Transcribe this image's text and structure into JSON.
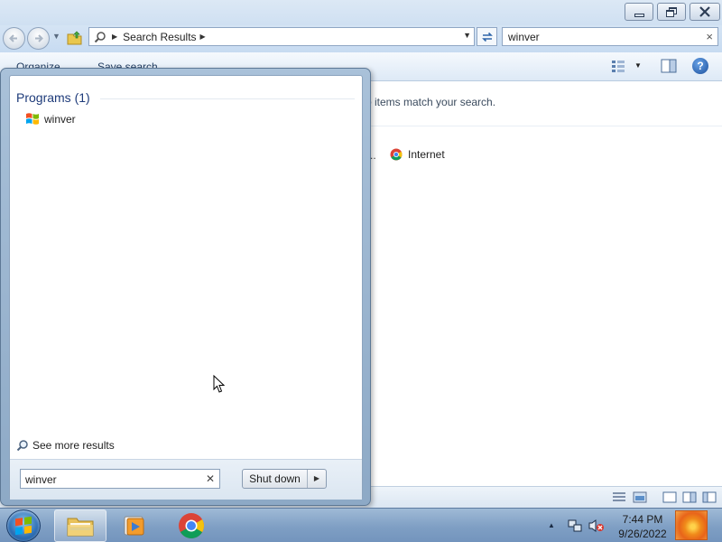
{
  "window": {
    "address": {
      "breadcrumb": "Search Results"
    },
    "search": {
      "value": "winver"
    },
    "commands": {
      "organize": "Organize",
      "save_search": "Save search"
    },
    "content": {
      "no_items_message": "o items match your search.",
      "truncated_text": "..",
      "search_again_item": "Internet"
    }
  },
  "start_menu": {
    "programs_heading": "Programs (1)",
    "results": [
      {
        "label": "winver"
      }
    ],
    "see_more": "See more results",
    "search_value": "winver",
    "shutdown_label": "Shut down"
  },
  "taskbar": {
    "clock": {
      "time": "7:44 PM",
      "date": "9/26/2022"
    },
    "pinned": [
      "Windows Explorer",
      "Windows Media Player",
      "Google Chrome"
    ]
  },
  "icons": {
    "back": "back-arrow-icon",
    "forward": "forward-arrow-icon",
    "search": "magnifier-icon",
    "refresh": "refresh-icon",
    "help": "help-icon",
    "chrome": "chrome-icon"
  },
  "colors": {
    "titlebar": "#dce8f5",
    "taskbar": "#7f9fc4",
    "heading": "#1e3b7a"
  }
}
